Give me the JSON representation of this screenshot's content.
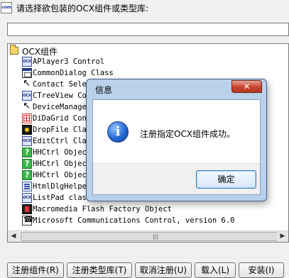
{
  "header": {
    "app_icon_text": "com",
    "prompt": "请选择欲包装的OCX组件或类型库:"
  },
  "search": {
    "value": ""
  },
  "tree": {
    "root_label": "OCX组件",
    "items": [
      {
        "label": "APlayer3 Control",
        "icon": "ocx-icon"
      },
      {
        "label": "CommonDialog Class",
        "icon": "dialog-icon"
      },
      {
        "label": "Contact Selector",
        "icon": "cursor-icon"
      },
      {
        "label": "CTreeView Control",
        "icon": "ocx-icon"
      },
      {
        "label": "DeviceManager",
        "icon": "cursor-icon"
      },
      {
        "label": "DiDaGrid Control",
        "icon": "grid-icon"
      },
      {
        "label": "DropFile Class",
        "icon": "dropfile-icon"
      },
      {
        "label": "EditCtrl Class",
        "icon": "ocx-icon"
      },
      {
        "label": "HHCtrl Object",
        "icon": "help-icon"
      },
      {
        "label": "HHCtrl Object",
        "icon": "help-icon"
      },
      {
        "label": "HHCtrl Object",
        "icon": "help-icon"
      },
      {
        "label": "HtmlDlgHelper",
        "icon": "html-icon"
      },
      {
        "label": "ListPad class",
        "icon": "ocx-icon"
      },
      {
        "label": "Macromedia Flash Factory Object",
        "icon": "flash-icon"
      },
      {
        "label": "Microsoft Communications Control, version 6.0",
        "icon": "comm-icon"
      }
    ]
  },
  "buttons": {
    "register_component": "注册组件(R)",
    "register_typelib": "注册类型库(T)",
    "unregister": "取消注册(U)",
    "load": "载入(L)",
    "install": "安装(I)"
  },
  "dialog": {
    "title": "信息",
    "close_glyph": "✕",
    "info_glyph": "i",
    "message": "注册指定OCX组件成功。",
    "ok_label": "确定"
  },
  "colors": {
    "dialog_frame": "#b9d1ea",
    "close_button": "#c7442d",
    "info_icon": "#1f63d0"
  }
}
